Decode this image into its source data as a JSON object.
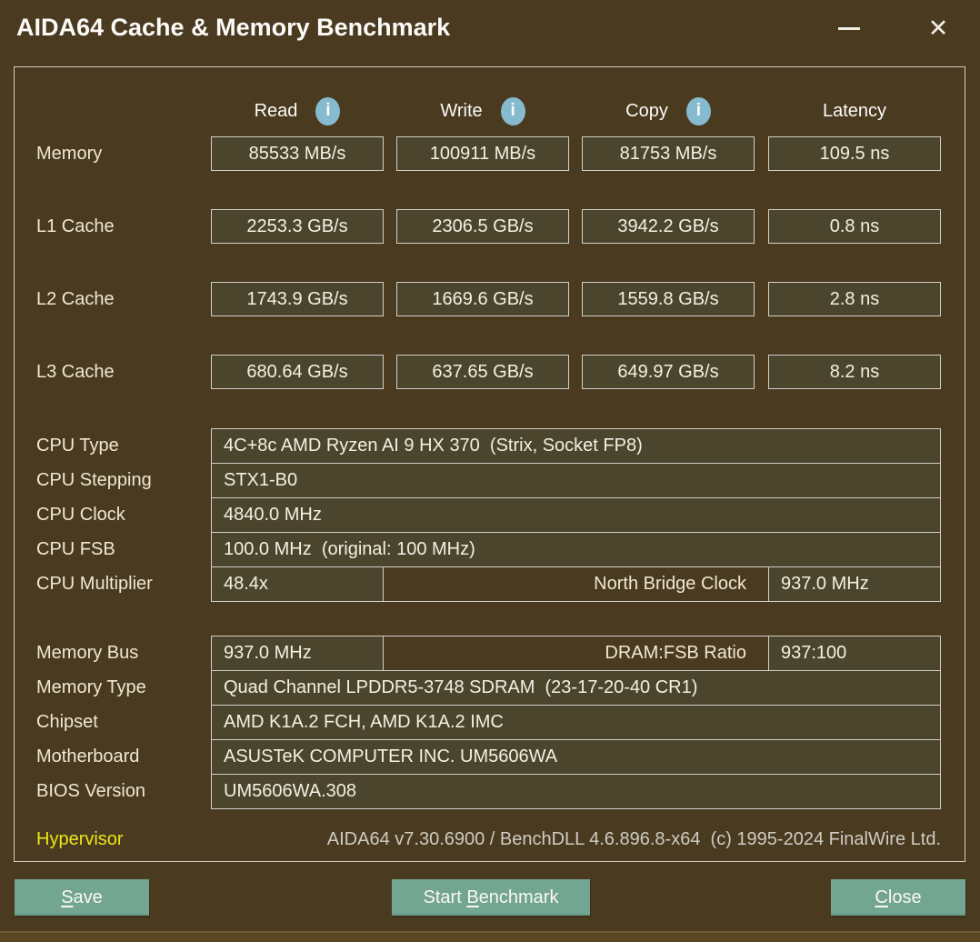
{
  "window": {
    "title": "AIDA64 Cache & Memory Benchmark",
    "controls": {
      "close_glyph": "✕"
    }
  },
  "icons": {
    "info": "i"
  },
  "colors": {
    "background": "#4a3a20",
    "cell_background": "#4c452e",
    "cell_border": "#d2cfc5",
    "button_accent": "#72a592",
    "info_icon_blue": "#85bacf",
    "hypervisor_yellow": "#ece617"
  },
  "benchmark": {
    "columns": [
      {
        "label": "Read",
        "has_info": true
      },
      {
        "label": "Write",
        "has_info": true
      },
      {
        "label": "Copy",
        "has_info": true
      },
      {
        "label": "Latency",
        "has_info": false
      }
    ],
    "rows": [
      {
        "label": "Memory",
        "read": "85533 MB/s",
        "write": "100911 MB/s",
        "copy": "81753 MB/s",
        "latency": "109.5 ns"
      },
      {
        "label": "L1 Cache",
        "read": "2253.3 GB/s",
        "write": "2306.5 GB/s",
        "copy": "3942.2 GB/s",
        "latency": "0.8 ns"
      },
      {
        "label": "L2 Cache",
        "read": "1743.9 GB/s",
        "write": "1669.6 GB/s",
        "copy": "1559.8 GB/s",
        "latency": "2.8 ns"
      },
      {
        "label": "L3 Cache",
        "read": "680.64 GB/s",
        "write": "637.65 GB/s",
        "copy": "649.97 GB/s",
        "latency": "8.2 ns"
      }
    ]
  },
  "system": {
    "rows_top": [
      {
        "label": "CPU Type",
        "value": "4C+8c AMD Ryzen AI 9 HX 370  (Strix, Socket FP8)"
      },
      {
        "label": "CPU Stepping",
        "value": "STX1-B0"
      },
      {
        "label": "CPU Clock",
        "value": "4840.0 MHz"
      },
      {
        "label": "CPU FSB",
        "value": "100.0 MHz  (original: 100 MHz)"
      }
    ],
    "multiplier_row": {
      "label": "CPU Multiplier",
      "value": "48.4x",
      "right_label": "North Bridge Clock",
      "right_value": "937.0 MHz"
    },
    "memory_bus_row": {
      "label": "Memory Bus",
      "value": "937.0 MHz",
      "right_label": "DRAM:FSB Ratio",
      "right_value": "937:100"
    },
    "rows_bottom": [
      {
        "label": "Memory Type",
        "value": "Quad Channel LPDDR5-3748 SDRAM  (23-17-20-40 CR1)"
      },
      {
        "label": "Chipset",
        "value": "AMD K1A.2 FCH, AMD K1A.2 IMC"
      },
      {
        "label": "Motherboard",
        "value": "ASUSTeK COMPUTER INC. UM5606WA"
      },
      {
        "label": "BIOS Version",
        "value": "UM5606WA.308"
      }
    ]
  },
  "footer": {
    "hypervisor_label": "Hypervisor",
    "version_text": "AIDA64 v7.30.6900 / BenchDLL 4.6.896.8-x64  (c) 1995-2024 FinalWire Ltd."
  },
  "buttons": {
    "save": {
      "pre": "",
      "accelerator": "S",
      "post": "ave"
    },
    "start_benchmark": {
      "pre": "Start ",
      "accelerator": "B",
      "post": "enchmark"
    },
    "close": {
      "pre": "",
      "accelerator": "C",
      "post": "lose"
    }
  }
}
